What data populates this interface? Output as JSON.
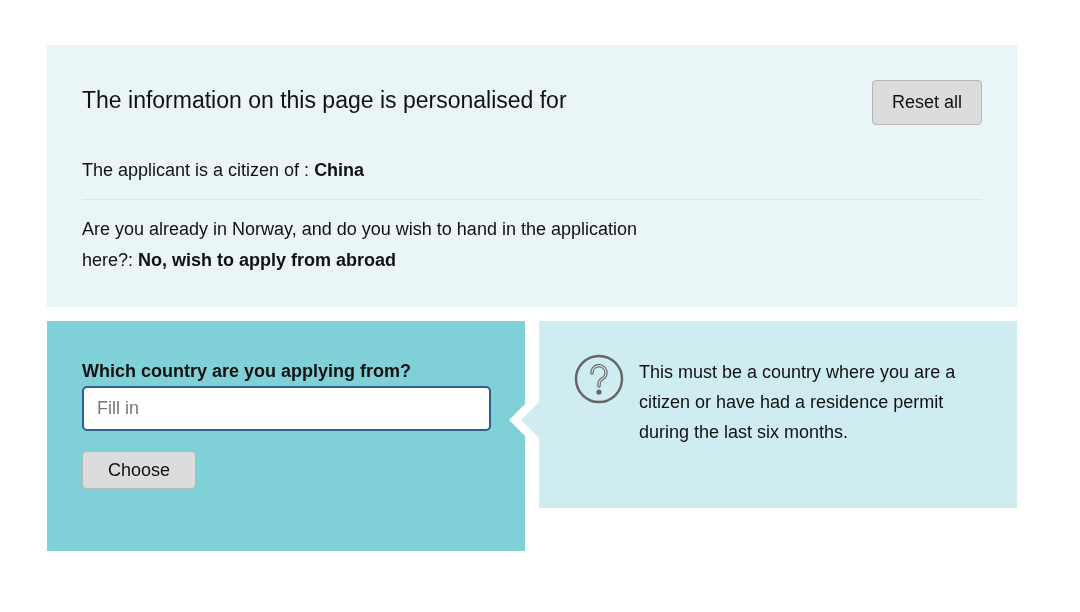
{
  "personalisation": {
    "title": "The information on this page is personalised for",
    "reset_button": "Reset all",
    "answers": [
      "The applicant is a citizen of : **China**",
      "Are you already in Norway, and do you wish to hand in the application here?: **No, wish to apply from abroad**"
    ]
  },
  "question": {
    "label": "Which country are you applying from?",
    "placeholder": "Fill in",
    "button": "Choose"
  },
  "help": {
    "text": "This must be a country where you are a citizen or have had a residence permit during the last six months."
  }
}
